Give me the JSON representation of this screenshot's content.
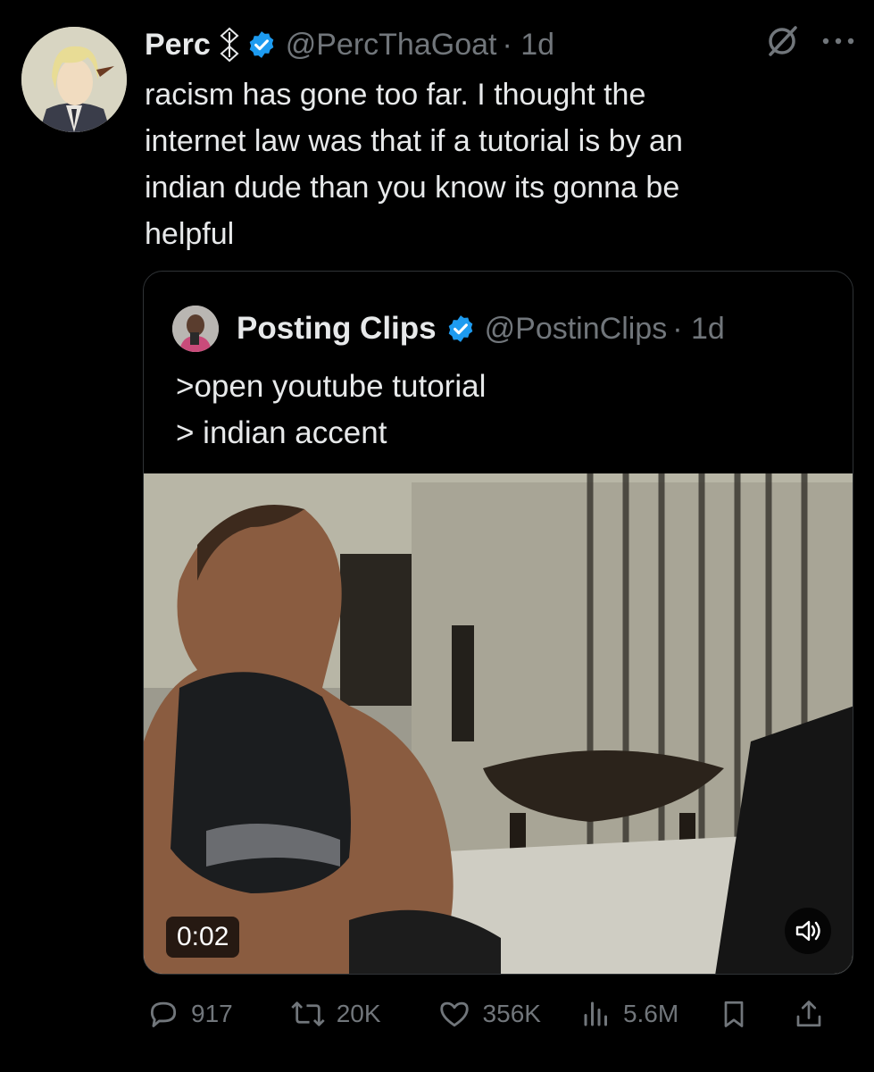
{
  "author": {
    "name": "Perc",
    "handle": "@PercThaGoat",
    "time": "· 1d"
  },
  "tweet": {
    "text": "racism has gone too far. I thought the\ninternet law was that if a tutorial is by an\nindian dude than you know its gonna be\nhelpful"
  },
  "quoted": {
    "name": "Posting Clips",
    "handle": "@PostinClips",
    "time": "· 1d",
    "text": ">open youtube tutorial\n> indian accent",
    "video": {
      "timestamp": "0:02"
    }
  },
  "actions": {
    "replies": "917",
    "reposts": "20K",
    "likes": "356K",
    "views": "5.6M"
  },
  "colors": {
    "background": "#000000",
    "text": "#e7e9ea",
    "muted": "#71767b",
    "verified": "#1d9bf0",
    "border": "#2f3336"
  },
  "icons": [
    "grok-icon",
    "more-icon",
    "verified-badge-icon",
    "reply-icon",
    "repost-icon",
    "like-icon",
    "views-icon",
    "bookmark-icon",
    "share-icon",
    "speaker-icon"
  ]
}
